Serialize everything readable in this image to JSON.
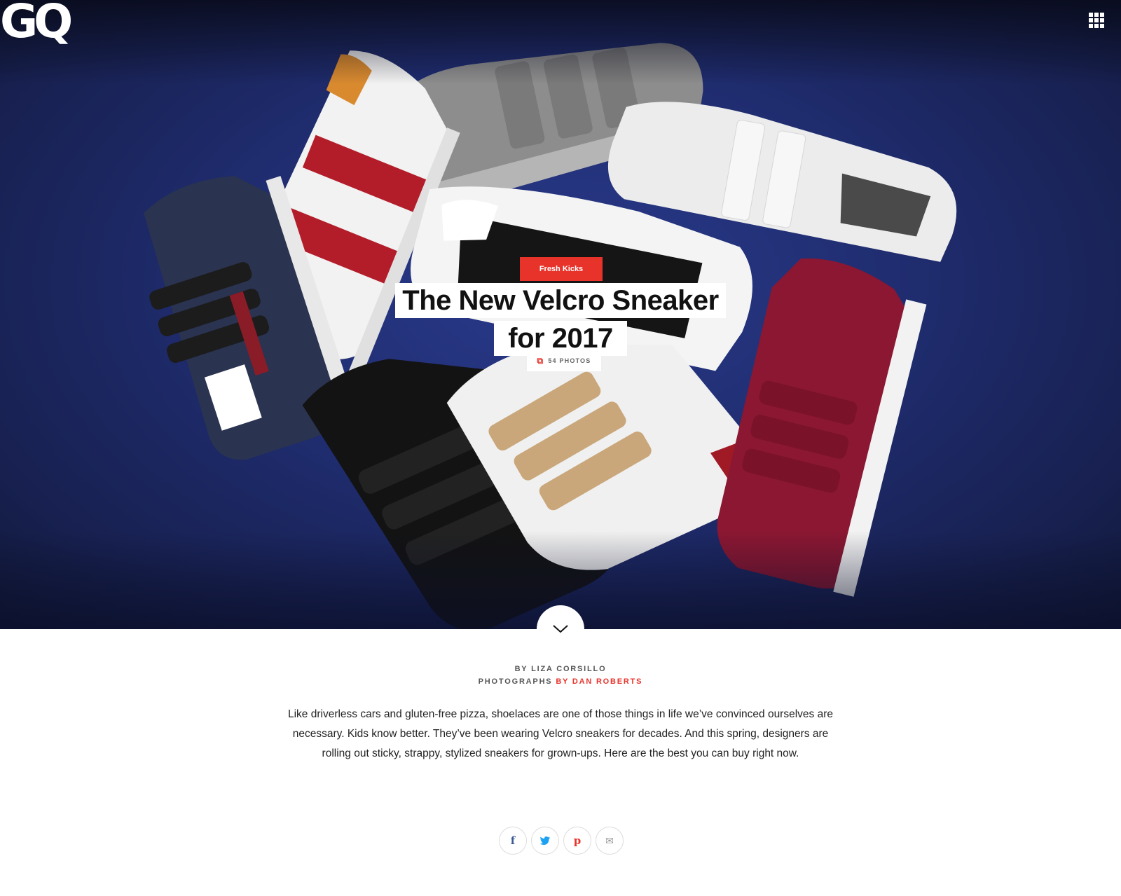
{
  "brand": {
    "logo_text": "GQ"
  },
  "header": {
    "menu_icon": "grid-menu-icon"
  },
  "hero": {
    "kicker": "Fresh Kicks",
    "headline_line1": "The New Velcro Sneaker",
    "headline_line2": "for 2017",
    "photo_count": "54 PHOTOS",
    "photo_icon": "gallery-icon",
    "scroll_icon": "chevron-down-icon"
  },
  "byline": {
    "author_prefix": "BY",
    "author": "LIZA CORSILLO",
    "photographs_label": "PHOTOGRAPHS",
    "photographer": "BY DAN ROBERTS"
  },
  "dek": "Like driverless cars and gluten-free pizza, shoelaces are one of those things in life we’ve convinced ourselves are necessary. Kids know better. They’ve been wearing Velcro sneakers for decades. And this spring, designers are rolling out sticky, strappy, stylized sneakers for grown-ups. Here are the best you can buy right now.",
  "share": [
    {
      "name": "facebook",
      "glyph": "f",
      "color": "#3b5998"
    },
    {
      "name": "twitter",
      "glyph": "t",
      "color": "#1da1f2"
    },
    {
      "name": "pinterest",
      "glyph": "p",
      "color": "#e8332b"
    },
    {
      "name": "email",
      "glyph": "✉",
      "color": "#999999"
    }
  ],
  "colors": {
    "accent": "#e8332b",
    "hero_bg": "#1f2c6e"
  }
}
